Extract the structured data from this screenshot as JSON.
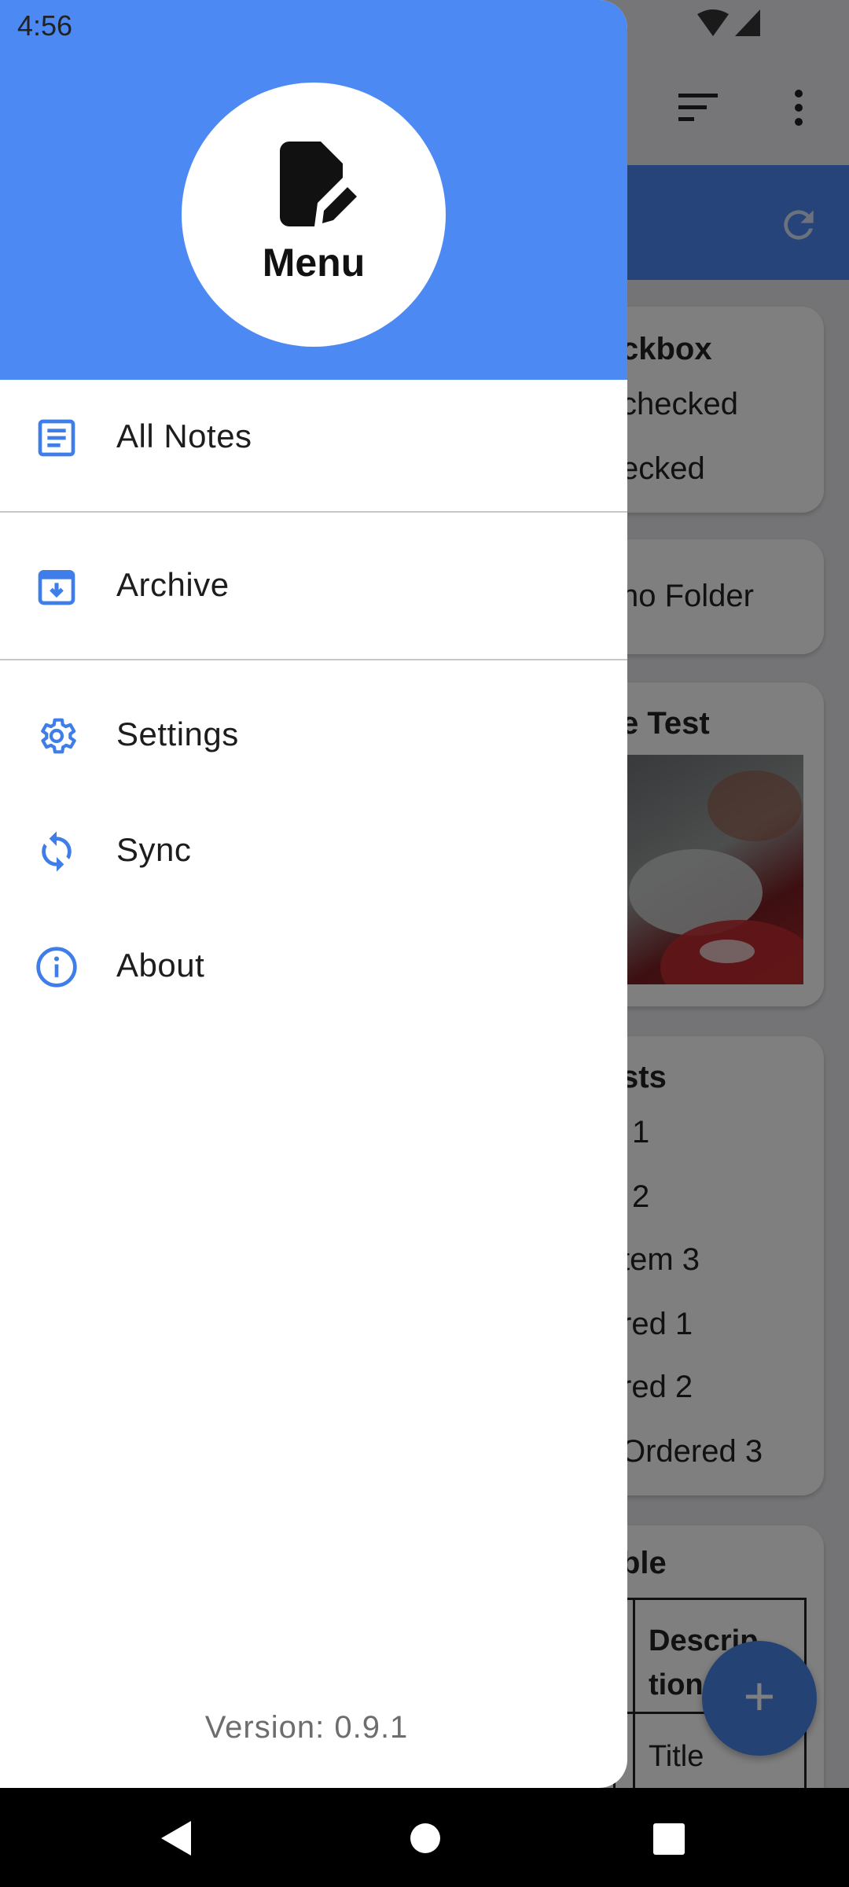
{
  "status_bar": {
    "time": "4:56",
    "icons": [
      "wifi-icon",
      "cellular-signal-icon"
    ]
  },
  "background_app": {
    "toolbar_icons": [
      "sort-icon",
      "more-vert-icon"
    ],
    "folder_bar_icon": "refresh-icon",
    "cards": [
      {
        "lines": [
          "ckbox",
          "checked",
          "ecked"
        ]
      },
      {
        "lines": [
          "no Folder"
        ]
      },
      {
        "lines": [
          "e Test"
        ]
      },
      {
        "lines": [
          "sts",
          "1",
          "2",
          "tem 3",
          "red 1",
          "red 2",
          "Ordered 3"
        ]
      },
      {
        "lines": [
          "ble"
        ]
      }
    ],
    "table": {
      "header": "Descrip tion",
      "cell": "Title"
    },
    "fab_icon": "add-icon"
  },
  "drawer": {
    "header_title": "Menu",
    "header_icon": "edit-note-icon",
    "items": [
      {
        "label": "All Notes",
        "icon": "notes-icon"
      },
      {
        "label": "Archive",
        "icon": "archive-icon"
      },
      {
        "label": "Settings",
        "icon": "settings-icon"
      },
      {
        "label": "Sync",
        "icon": "sync-icon"
      },
      {
        "label": "About",
        "icon": "info-icon"
      }
    ],
    "version": "Version: 0.9.1"
  },
  "nav_bar": {
    "buttons": [
      "back-icon",
      "home-icon",
      "recents-icon"
    ]
  },
  "colors": {
    "accent": "#4c89f2",
    "icon_blue": "#3f7ee8",
    "scrim": "rgba(0,0,0,0.5)",
    "drawer_bg": "#ffffff"
  }
}
